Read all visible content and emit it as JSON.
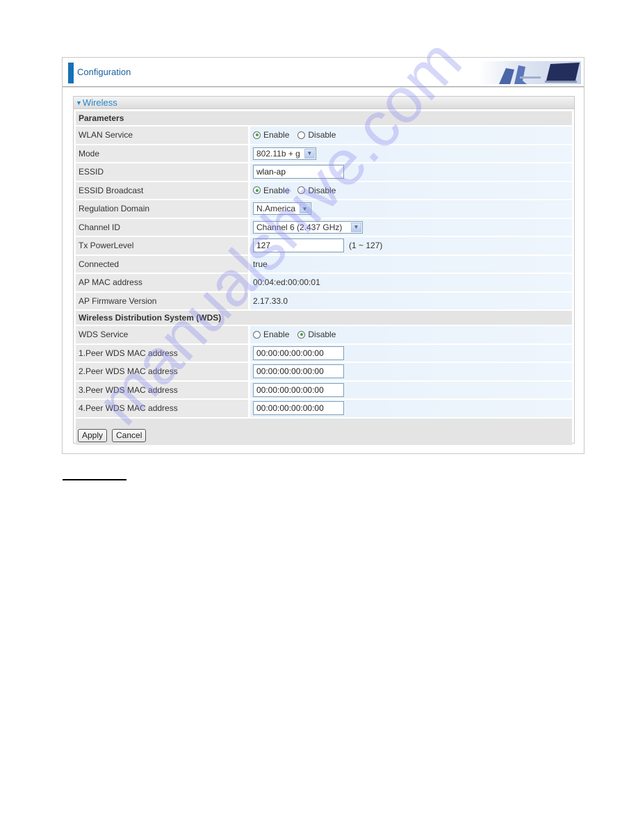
{
  "banner": {
    "title": "Configuration",
    "image": "office-chairs-monitor-banner-image"
  },
  "panel": {
    "title": "Wireless",
    "collapse_icon": "triangle-down-icon"
  },
  "sections": {
    "parameters": "Parameters",
    "wds": "Wireless Distribution System (WDS)"
  },
  "fields": {
    "wlan_service": {
      "label": "WLAN Service",
      "options": [
        "Enable",
        "Disable"
      ],
      "selected": "Enable"
    },
    "mode": {
      "label": "Mode",
      "value": "802.11b + g"
    },
    "essid": {
      "label": "ESSID",
      "value": "wlan-ap"
    },
    "essid_broadcast": {
      "label": "ESSID Broadcast",
      "options": [
        "Enable",
        "Disable"
      ],
      "selected": "Enable"
    },
    "regulation_domain": {
      "label": "Regulation Domain",
      "value": "N.America"
    },
    "channel_id": {
      "label": "Channel ID",
      "value": "Channel 6 (2.437 GHz)"
    },
    "tx_power": {
      "label": "Tx PowerLevel",
      "value": "127",
      "hint": "(1 ~ 127)"
    },
    "connected": {
      "label": "Connected",
      "value": "true"
    },
    "ap_mac": {
      "label": "AP MAC address",
      "value": "00:04:ed:00:00:01"
    },
    "ap_firmware": {
      "label": "AP Firmware Version",
      "value": "2.17.33.0"
    },
    "wds_service": {
      "label": "WDS Service",
      "options": [
        "Enable",
        "Disable"
      ],
      "selected": "Disable"
    },
    "peers": [
      {
        "label": "1.Peer WDS MAC address",
        "value": "00:00:00:00:00:00"
      },
      {
        "label": "2.Peer WDS MAC address",
        "value": "00:00:00:00:00:00"
      },
      {
        "label": "3.Peer WDS MAC address",
        "value": "00:00:00:00:00:00"
      },
      {
        "label": "4.Peer WDS MAC address",
        "value": "00:00:00:00:00:00"
      }
    ]
  },
  "buttons": {
    "apply": "Apply",
    "cancel": "Cancel"
  },
  "watermark": "manualshive.com",
  "colors": {
    "accent": "#1472b8",
    "panel_title": "#2a86c8",
    "radio_dot": "#3aa847"
  }
}
